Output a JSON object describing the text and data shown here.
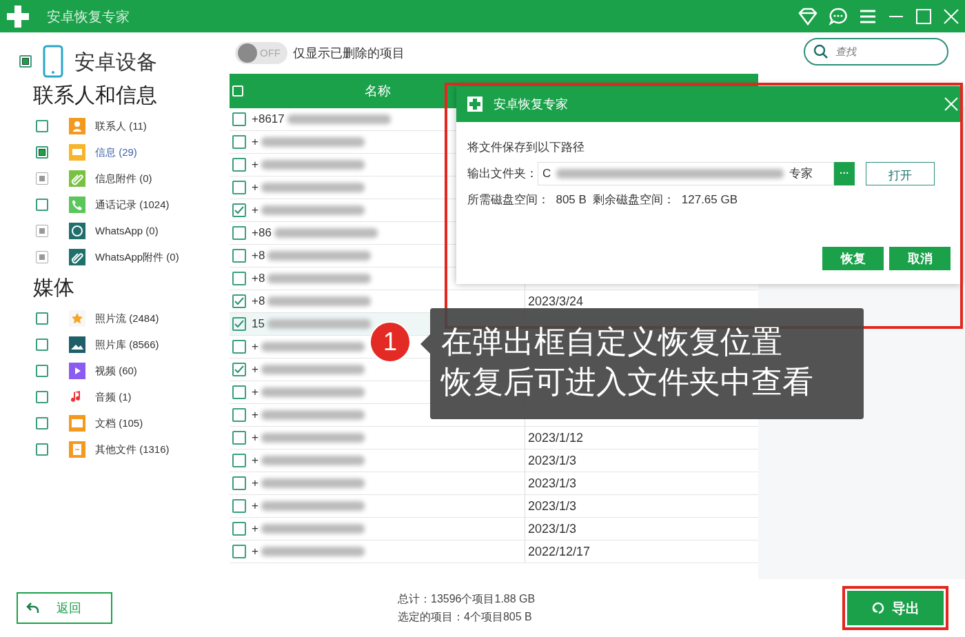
{
  "window": {
    "title": "安卓恢复专家"
  },
  "sidebar": {
    "device": {
      "label": "安卓设备",
      "checked": true
    },
    "sections": [
      {
        "title": "联系人和信息",
        "items": [
          {
            "label": "联系人 (11)",
            "checked": false,
            "disabled": false,
            "selected": false
          },
          {
            "label": "信息 (29)",
            "checked": true,
            "disabled": false,
            "selected": true
          },
          {
            "label": "信息附件 (0)",
            "checked": true,
            "disabled": true,
            "selected": false
          },
          {
            "label": "通话记录 (1024)",
            "checked": false,
            "disabled": false,
            "selected": false
          },
          {
            "label": "WhatsApp (0)",
            "checked": true,
            "disabled": true,
            "selected": false
          },
          {
            "label": "WhatsApp附件 (0)",
            "checked": true,
            "disabled": true,
            "selected": false
          }
        ]
      },
      {
        "title": "媒体",
        "items": [
          {
            "label": "照片流 (2484)",
            "checked": false,
            "disabled": false,
            "selected": false
          },
          {
            "label": "照片库 (8566)",
            "checked": false,
            "disabled": false,
            "selected": false
          },
          {
            "label": "视频 (60)",
            "checked": false,
            "disabled": false,
            "selected": false
          },
          {
            "label": "音频 (1)",
            "checked": false,
            "disabled": false,
            "selected": false
          },
          {
            "label": "文档 (105)",
            "checked": false,
            "disabled": false,
            "selected": false
          },
          {
            "label": "其他文件 (1316)",
            "checked": false,
            "disabled": false,
            "selected": false
          }
        ]
      }
    ]
  },
  "filter": {
    "on": false,
    "state_text": "OFF",
    "label": "仅显示已删除的项目"
  },
  "search": {
    "placeholder": "查找"
  },
  "table": {
    "columns": [
      "名称"
    ],
    "select_all_checked": false,
    "rows": [
      {
        "name": "+8617",
        "checked": false,
        "selected": false
      },
      {
        "name": "+",
        "checked": false,
        "selected": false
      },
      {
        "name": "+",
        "checked": false,
        "selected": false
      },
      {
        "name": "+",
        "checked": false,
        "selected": false
      },
      {
        "name": "+",
        "checked": true,
        "selected": false
      },
      {
        "name": "+86",
        "checked": false,
        "selected": false
      },
      {
        "name": "+8",
        "checked": false,
        "selected": false
      },
      {
        "name": "+8",
        "checked": false,
        "selected": false
      },
      {
        "name": "+8",
        "checked": true,
        "selected": false,
        "date": "2023/3/24"
      },
      {
        "name": "15",
        "checked": true,
        "selected": true
      },
      {
        "name": "+",
        "checked": false,
        "selected": false
      },
      {
        "name": "+",
        "checked": true,
        "selected": false
      },
      {
        "name": "+",
        "checked": false,
        "selected": false
      },
      {
        "name": "+",
        "checked": false,
        "selected": false
      },
      {
        "name": "+",
        "checked": false,
        "selected": false,
        "date": "2023/1/12"
      },
      {
        "name": "+",
        "checked": false,
        "selected": false,
        "date": "2023/1/3"
      },
      {
        "name": "+",
        "checked": false,
        "selected": false,
        "date": "2023/1/3"
      },
      {
        "name": "+",
        "checked": false,
        "selected": false,
        "date": "2023/1/3"
      },
      {
        "name": "+",
        "checked": false,
        "selected": false,
        "date": "2023/1/3"
      },
      {
        "name": "+",
        "checked": false,
        "selected": false,
        "date": "2022/12/17"
      }
    ]
  },
  "dialog": {
    "title": "安卓恢复专家",
    "highlight": true,
    "message": "将文件保存到以下路径",
    "folder_label": "输出文件夹：",
    "folder_start": "C",
    "folder_end": "专家",
    "browse": "···",
    "open": "打开",
    "space": "所需磁盘空间：  805 B  剩余磁盘空间：  127.65 GB",
    "buttons": [
      "恢复",
      "取消"
    ]
  },
  "callout": {
    "number": "1",
    "lines": [
      "在弹出框自定义恢复位置",
      "恢复后可进入文件夹中查看"
    ]
  },
  "footer": {
    "back": "返回",
    "total": "总计：13596个项目1.88 GB",
    "selected_summary": "选定的项目：4个项目805 B",
    "export": "导出",
    "export_highlight": true
  }
}
